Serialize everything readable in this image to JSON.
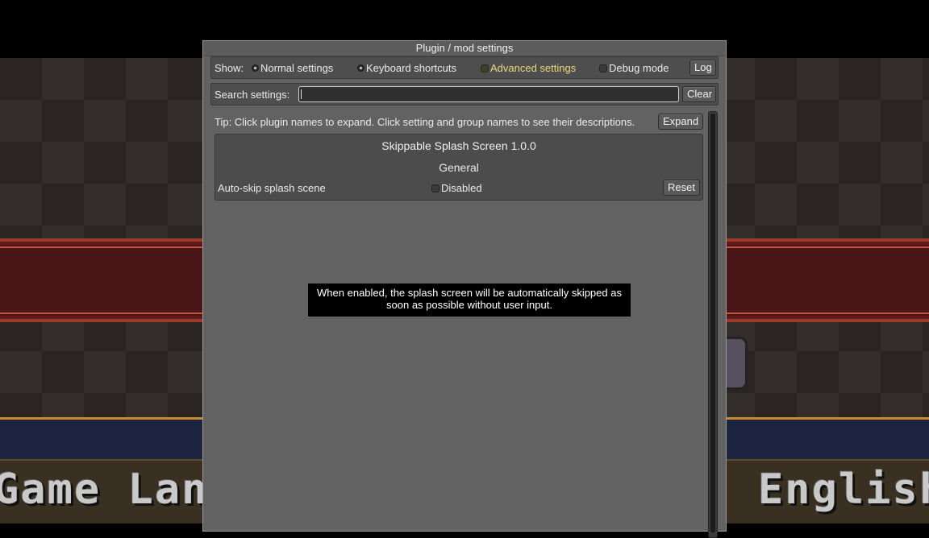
{
  "background": {
    "left_text": "Game Langu",
    "right_text": "English"
  },
  "dialog": {
    "title": "Plugin / mod settings",
    "show_label": "Show:",
    "options": [
      {
        "label": "Normal settings",
        "control": "radio",
        "checked": true
      },
      {
        "label": "Keyboard shortcuts",
        "control": "radio",
        "checked": true
      },
      {
        "label": "Advanced settings",
        "control": "checkbox",
        "checked": false,
        "color": "#e8d878"
      },
      {
        "label": "Debug mode",
        "control": "checkbox",
        "checked": false
      }
    ],
    "log_button": "Log",
    "search": {
      "label": "Search settings:",
      "value": "",
      "placeholder": "",
      "clear_button": "Clear"
    },
    "tip": "Tip: Click plugin names to expand. Click setting and group names to see their descriptions.",
    "expand_button": "Expand",
    "plugin": {
      "name": "Skippable Splash Screen 1.0.0",
      "group": "General",
      "setting": {
        "name": "Auto-skip splash scene",
        "value_label": "Disabled",
        "checked": false,
        "reset_button": "Reset"
      }
    },
    "tooltip": "When enabled, the splash screen will be automatically skipped as soon as possible without user input."
  }
}
